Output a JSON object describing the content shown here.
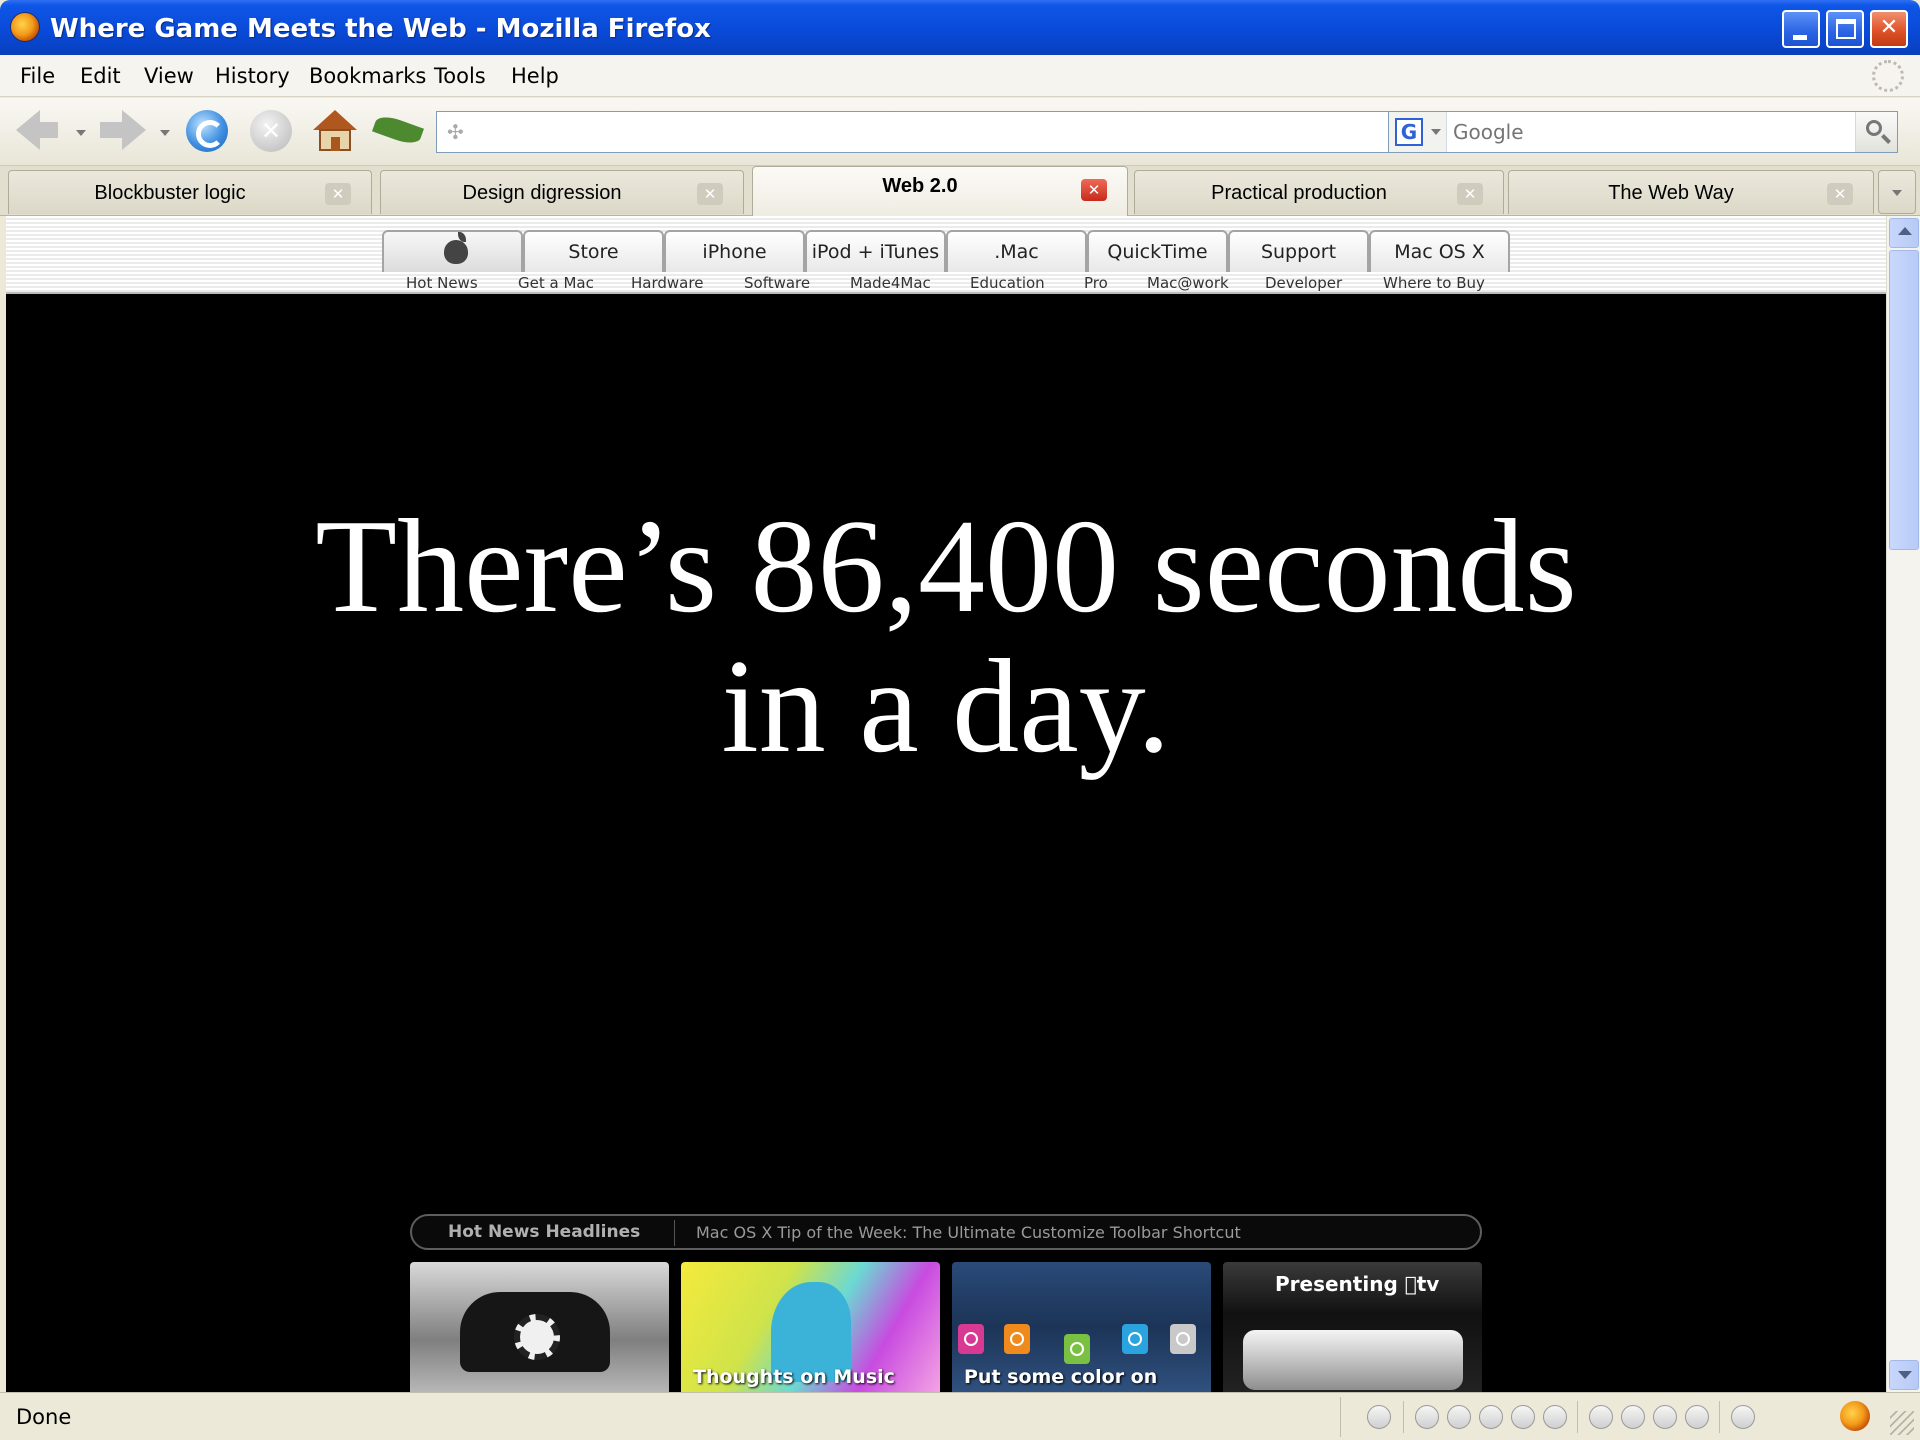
{
  "window": {
    "title": "Where Game Meets the Web - Mozilla Firefox"
  },
  "menu": {
    "items": [
      "File",
      "Edit",
      "View",
      "History",
      "Bookmarks",
      "Tools",
      "Help"
    ]
  },
  "navigation": {
    "url": "",
    "search_placeholder": "Google",
    "icons": [
      "back-icon",
      "forward-icon",
      "reload-icon",
      "stop-icon",
      "home-icon",
      "leaf-icon",
      "rss-icon",
      "go-icon",
      "google-icon",
      "search-icon"
    ]
  },
  "tabs": [
    {
      "label": "Blockbuster logic",
      "active": false
    },
    {
      "label": "Design digression",
      "active": false
    },
    {
      "label": "Web 2.0",
      "active": true
    },
    {
      "label": "Practical production",
      "active": false
    },
    {
      "label": "The Web Way",
      "active": false
    }
  ],
  "page": {
    "nav_tabs": [
      "Store",
      "iPhone",
      "iPod + iTunes",
      ".Mac",
      "QuickTime",
      "Support",
      "Mac OS X"
    ],
    "nav_subitems": [
      "Hot News",
      "Get a Mac",
      "Hardware",
      "Software",
      "Made4Mac",
      "Education",
      "Pro",
      "Mac@work",
      "Developer",
      "Where to Buy"
    ],
    "headline_line1": "There’s 86,400 seconds",
    "headline_line2": "in a day.",
    "news_label": "Hot News Headlines",
    "news_text": "Mac OS X Tip of the Week: The Ultimate Customize Toolbar Shortcut",
    "promos": {
      "music_caption": "Thoughts on Music",
      "ipod_caption": "Put some color on",
      "tv_title": "Presenting tv"
    }
  },
  "status": {
    "text": "Done"
  },
  "colors": {
    "titlebar": "#0a4ad8",
    "page_background": "#000000",
    "headline": "#ffffff",
    "active_tab_close": "#c72a1a"
  }
}
